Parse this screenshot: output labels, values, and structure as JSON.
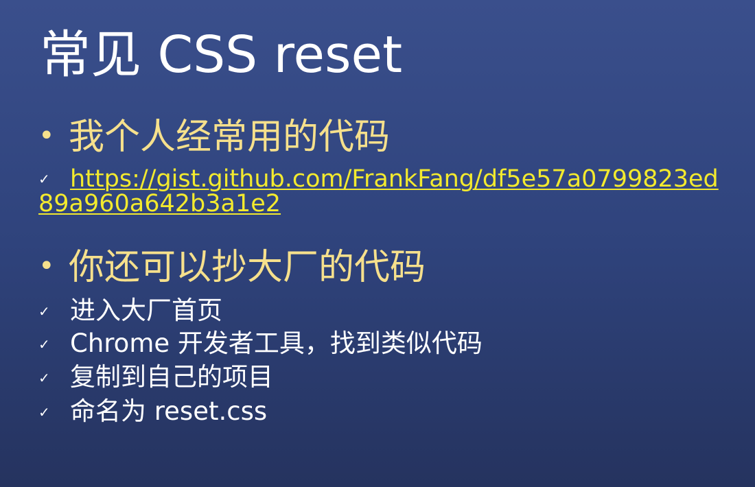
{
  "title": "常见 CSS reset",
  "sections": [
    {
      "heading": "我个人经常用的代码",
      "items": [
        {
          "text": "https://gist.github.com/FrankFang/df5e57a0799823ed89a960a642b3a1e2"
        }
      ]
    },
    {
      "heading": "你还可以抄大厂的代码",
      "items": [
        {
          "text": "进入大厂首页"
        },
        {
          "text": "Chrome 开发者工具，找到类似代码"
        },
        {
          "text": "复制到自己的项目"
        },
        {
          "text": "命名为 reset.css"
        }
      ]
    }
  ],
  "bullet_symbol": "•",
  "check_symbol": "✓",
  "colors": {
    "background_top": "#3a4f8c",
    "background_bottom": "#25335f",
    "heading": "#f6e08c",
    "link": "#f3ea2e",
    "text": "#ffffff"
  }
}
